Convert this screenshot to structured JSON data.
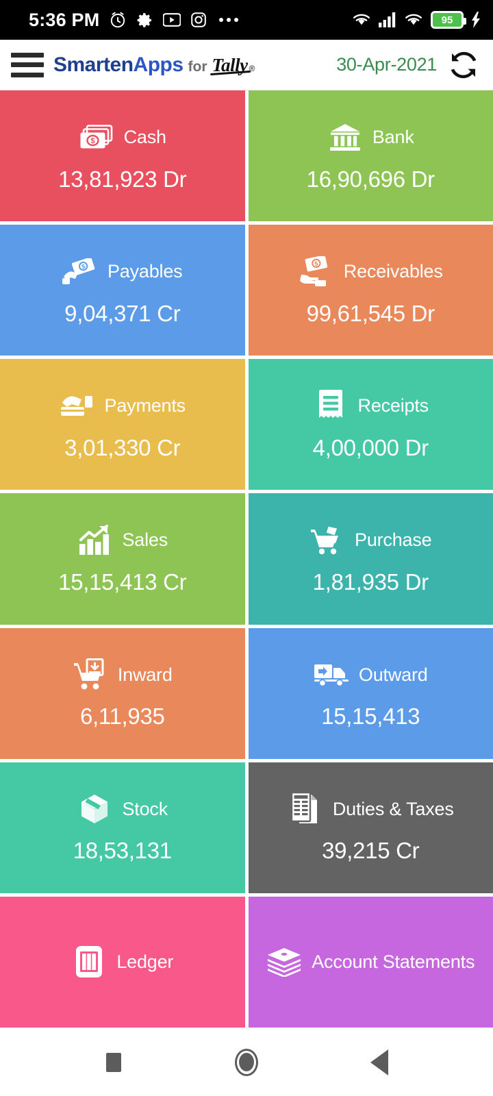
{
  "status_bar": {
    "time": "5:36 PM",
    "left_icons": [
      "alarm-icon",
      "gear-icon",
      "youtube-icon",
      "instagram-icon",
      "more-dots-icon"
    ],
    "right_icons": [
      "wifi-icon",
      "signal-bars-icon",
      "wifi-icon"
    ],
    "battery_level": "95",
    "battery_charging": true,
    "background": "#000000"
  },
  "appbar": {
    "menu_icon": "hamburger-icon",
    "brand": {
      "part1": "Smarten",
      "part2": "Apps",
      "connector": "for",
      "product": "Tally",
      "trademark": "®"
    },
    "date": "30-Apr-2021",
    "date_color": "#3a8c4e",
    "refresh_icon": "refresh-sync-icon",
    "background": "#ffffff"
  },
  "dashboard": {
    "tiles": [
      {
        "id": "cash",
        "label": "Cash",
        "value": "13,81,923 Dr",
        "color": "#E8505F",
        "icon": "money-stack-icon"
      },
      {
        "id": "bank",
        "label": "Bank",
        "value": "16,90,696 Dr",
        "color": "#8DC454",
        "icon": "bank-building-icon"
      },
      {
        "id": "payables",
        "label": "Payables",
        "value": "9,04,371 Cr",
        "color": "#5B9BE8",
        "icon": "hand-pay-money-icon"
      },
      {
        "id": "receivables",
        "label": "Receivables",
        "value": "99,61,545 Dr",
        "color": "#E8885B",
        "icon": "hand-receive-money-icon"
      },
      {
        "id": "payments",
        "label": "Payments",
        "value": "3,01,330 Cr",
        "color": "#E8BC4D",
        "icon": "wallet-card-icon"
      },
      {
        "id": "receipts",
        "label": "Receipts",
        "value": "4,00,000 Dr",
        "color": "#45C9A5",
        "icon": "receipt-icon"
      },
      {
        "id": "sales",
        "label": "Sales",
        "value": "15,15,413 Cr",
        "color": "#8DC454",
        "icon": "bar-chart-up-icon"
      },
      {
        "id": "purchase",
        "label": "Purchase",
        "value": "1,81,935 Dr",
        "color": "#3CB4AC",
        "icon": "shopping-cart-icon"
      },
      {
        "id": "inward",
        "label": "Inward",
        "value": "6,11,935",
        "color": "#E8885B",
        "icon": "cart-inward-icon"
      },
      {
        "id": "outward",
        "label": "Outward",
        "value": "15,15,413",
        "color": "#5B9BE8",
        "icon": "truck-outward-icon"
      },
      {
        "id": "stock",
        "label": "Stock",
        "value": "18,53,131",
        "color": "#45C9A5",
        "icon": "box-package-icon"
      },
      {
        "id": "duties-taxes",
        "label": "Duties & Taxes",
        "value": "39,215 Cr",
        "color": "#636363",
        "icon": "tax-document-icon"
      },
      {
        "id": "ledger",
        "label": "Ledger",
        "value": "",
        "color": "#F9598A",
        "icon": "ledger-book-icon"
      },
      {
        "id": "account-statements",
        "label": "Account Statements",
        "value": "",
        "color": "#C667E0",
        "icon": "stacked-books-icon"
      }
    ]
  },
  "navbar": {
    "recents_label": "Recents",
    "home_label": "Home",
    "back_label": "Back",
    "background": "#ffffff"
  }
}
